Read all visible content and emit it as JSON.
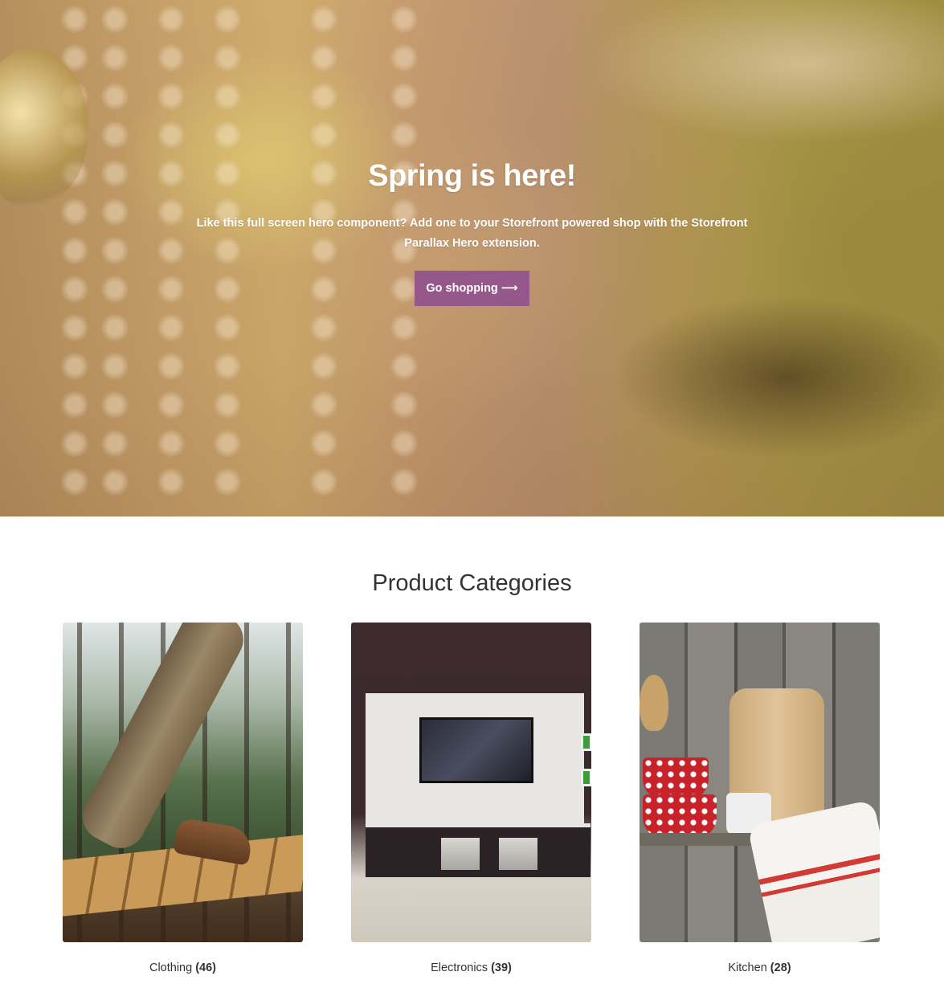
{
  "hero": {
    "title": "Spring is here!",
    "text": "Like this full screen hero component? Add one to your Storefront powered shop with the Storefront Parallax Hero extension.",
    "button_label": "Go shopping ⟶",
    "button_color": "#96588a"
  },
  "categories": {
    "title": "Product Categories",
    "items": [
      {
        "name": "Clothing",
        "count": "(46)"
      },
      {
        "name": "Electronics",
        "count": "(39)"
      },
      {
        "name": "Kitchen",
        "count": "(28)"
      }
    ]
  }
}
